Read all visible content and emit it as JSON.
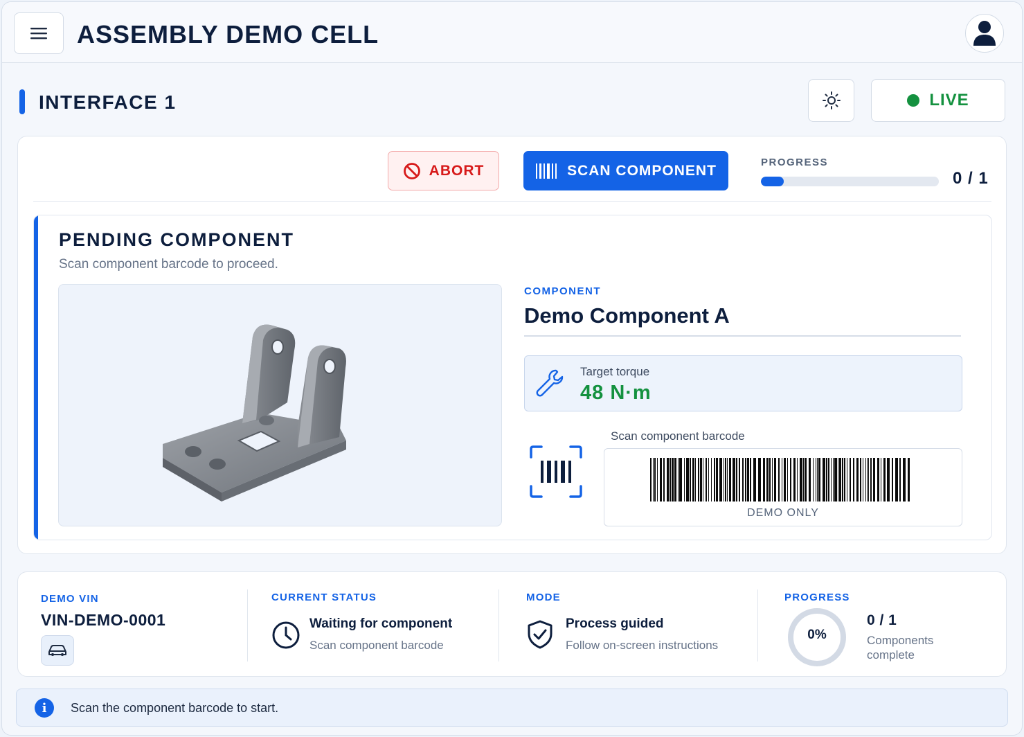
{
  "header": {
    "title": "ASSEMBLY DEMO CELL",
    "menu_icon": "hamburger-menu-icon",
    "user_icon": "user-icon"
  },
  "interface": {
    "title": "INTERFACE 1",
    "theme_icon": "sun-icon",
    "live_label": "LIVE",
    "live_color": "#14913f"
  },
  "toolbar": {
    "abort_label": "ABORT",
    "scan_label": "SCAN COMPONENT",
    "progress_label": "PROGRESS",
    "progress_count": "0 / 1",
    "progress_fraction": 0.13
  },
  "pending": {
    "title": "PENDING COMPONENT",
    "subtitle": "Scan component barcode to proceed.",
    "component_kicker": "COMPONENT",
    "component_name": "Demo Component A",
    "torque_label": "Target torque",
    "torque_value": "48 N·m",
    "scan_caption": "Scan component barcode",
    "barcode_note": "DEMO ONLY"
  },
  "summary": {
    "vin_kicker": "DEMO VIN",
    "vin_value": "VIN-DEMO-0001",
    "status_kicker": "CURRENT STATUS",
    "status_main": "Waiting for component",
    "status_sub": "Scan component barcode",
    "mode_kicker": "MODE",
    "mode_main": "Process guided",
    "mode_sub": "Follow on-screen instructions",
    "progress_kicker": "PROGRESS",
    "progress_percent": "0%",
    "progress_count": "0 / 1",
    "progress_sub_line1": "Components",
    "progress_sub_line2": "complete"
  },
  "info": {
    "message": "Scan the component barcode to start."
  },
  "colors": {
    "accent": "#1463e6",
    "danger": "#d71a1a",
    "success": "#14913f"
  }
}
